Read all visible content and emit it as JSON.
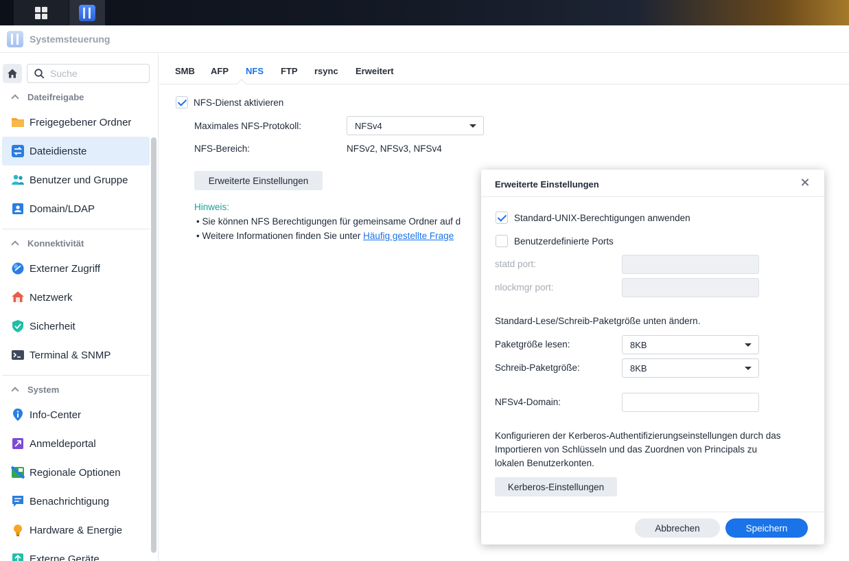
{
  "window": {
    "title": "Systemsteuerung"
  },
  "sidebar": {
    "search_placeholder": "Suche",
    "sections": [
      {
        "title": "Dateifreigabe"
      },
      {
        "title": "Konnektivität"
      },
      {
        "title": "System"
      }
    ],
    "items": [
      {
        "label": "Freigegebener Ordner",
        "icon": "folder-icon"
      },
      {
        "label": "Dateidienste",
        "icon": "file-services-icon",
        "active": true
      },
      {
        "label": "Benutzer und Gruppe",
        "icon": "users-icon"
      },
      {
        "label": "Domain/LDAP",
        "icon": "domain-icon"
      },
      {
        "label": "Externer Zugriff",
        "icon": "external-access-icon"
      },
      {
        "label": "Netzwerk",
        "icon": "network-icon"
      },
      {
        "label": "Sicherheit",
        "icon": "shield-icon"
      },
      {
        "label": "Terminal & SNMP",
        "icon": "terminal-icon"
      },
      {
        "label": "Info-Center",
        "icon": "info-icon"
      },
      {
        "label": "Anmeldeportal",
        "icon": "login-portal-icon"
      },
      {
        "label": "Regionale Optionen",
        "icon": "regional-icon"
      },
      {
        "label": "Benachrichtigung",
        "icon": "notification-icon"
      },
      {
        "label": "Hardware & Energie",
        "icon": "bulb-icon"
      },
      {
        "label": "Externe Geräte",
        "icon": "external-devices-icon"
      }
    ]
  },
  "tabs": [
    "SMB",
    "AFP",
    "NFS",
    "FTP",
    "rsync",
    "Erweitert"
  ],
  "active_tab": "NFS",
  "nfs": {
    "enable_label": "NFS-Dienst aktivieren",
    "enabled": true,
    "max_protocol_label": "Maximales NFS-Protokoll:",
    "max_protocol_value": "NFSv4",
    "range_label": "NFS-Bereich:",
    "range_value": "NFSv2, NFSv3, NFSv4",
    "advanced_button": "Erweiterte Einstellungen",
    "note_title": "Hinweis:",
    "note_1": "• Sie können NFS Berechtigungen für gemeinsame Ordner auf d",
    "note_2_prefix": "• Weitere Informationen finden Sie unter ",
    "note_2_link": "Häufig gestellte Frage"
  },
  "modal": {
    "title": "Erweiterte Einstellungen",
    "unix_perm_label": "Standard-UNIX-Berechtigungen anwenden",
    "unix_perm_checked": true,
    "custom_ports_label": "Benutzerdefinierte Ports",
    "custom_ports_checked": false,
    "statd_label": "statd port:",
    "statd_value": "",
    "nlockmgr_label": "nlockmgr port:",
    "nlockmgr_value": "",
    "packet_note": "Standard-Lese/Schreib-Paketgröße unten ändern.",
    "read_label": "Paketgröße lesen:",
    "read_value": "8KB",
    "write_label": "Schreib-Paketgröße:",
    "write_value": "8KB",
    "domain_label": "NFSv4-Domain:",
    "domain_value": "",
    "kerberos_text_1": "Konfigurieren der Kerberos-Authentifizierungseinstellungen durch das",
    "kerberos_text_2": "Importieren von Schlüsseln und das Zuordnen von Principals zu",
    "kerberos_text_3": "lokalen Benutzerkonten.",
    "kerberos_button": "Kerberos-Einstellungen",
    "cancel_button": "Abbrechen",
    "save_button": "Speichern"
  },
  "colors": {
    "accent": "#1a73e8",
    "active_bg": "#e2eefb",
    "hint": "#17a399"
  }
}
